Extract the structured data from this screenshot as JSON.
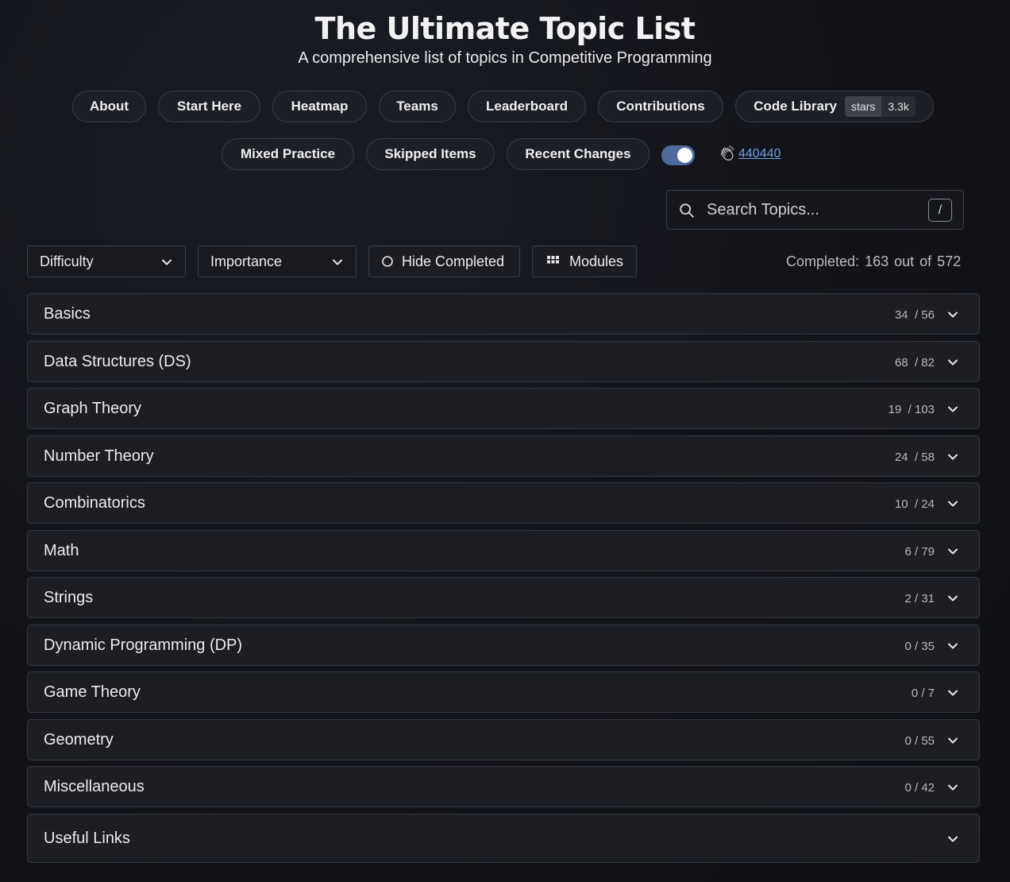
{
  "header": {
    "title": "The Ultimate Topic List",
    "subtitle": "A comprehensive list of topics in Competitive Programming"
  },
  "nav": {
    "about": "About",
    "start_here": "Start Here",
    "heatmap": "Heatmap",
    "teams": "Teams",
    "leaderboard": "Leaderboard",
    "contributions": "Contributions",
    "code_library": "Code Library",
    "stars_label": "stars",
    "stars_count": "3.3k",
    "mixed_practice": "Mixed Practice",
    "skipped_items": "Skipped Items",
    "recent_changes": "Recent Changes",
    "theme_toggle_on": true,
    "visit_count": "440440"
  },
  "search": {
    "placeholder": "Search Topics...",
    "shortcut": "/"
  },
  "filters": {
    "difficulty": "Difficulty",
    "importance": "Importance",
    "hide_completed": "Hide Completed",
    "modules": "Modules"
  },
  "progress": {
    "label": "Completed:",
    "done": "163",
    "out_of": "out of 572"
  },
  "sections": [
    {
      "name": "Basics",
      "count": "34  / 56"
    },
    {
      "name": "Data Structures (DS)",
      "count": "68  / 82"
    },
    {
      "name": "Graph Theory",
      "count": "19  / 103"
    },
    {
      "name": "Number Theory",
      "count": "24  / 58"
    },
    {
      "name": "Combinatorics",
      "count": "10  / 24"
    },
    {
      "name": "Math",
      "count": "6 / 79"
    },
    {
      "name": "Strings",
      "count": "2 / 31"
    },
    {
      "name": "Dynamic Programming (DP)",
      "count": "0 / 35"
    },
    {
      "name": "Game Theory",
      "count": "0 / 7"
    },
    {
      "name": "Geometry",
      "count": "0 / 55"
    },
    {
      "name": "Miscellaneous",
      "count": "0 / 42"
    },
    {
      "name": "Useful Links",
      "count": ""
    }
  ],
  "colors": {
    "background": "#121318",
    "accent_toggle": "#4f6b9e",
    "link": "#6ea0e6"
  }
}
